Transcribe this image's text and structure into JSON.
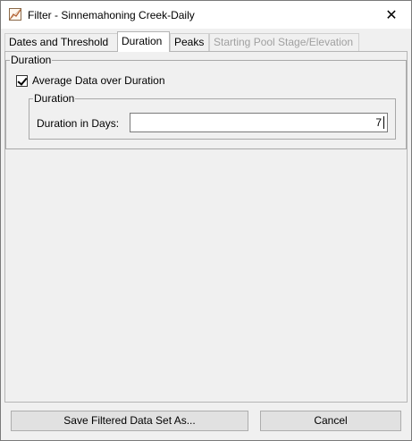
{
  "window": {
    "title": "Filter - Sinnemahoning Creek-Daily",
    "close_glyph": "✕"
  },
  "tabs": [
    {
      "label": "Dates and Threshold",
      "state": "normal"
    },
    {
      "label": "Duration",
      "state": "active"
    },
    {
      "label": "Peaks",
      "state": "normal"
    },
    {
      "label": "Starting Pool Stage/Elevation",
      "state": "disabled"
    }
  ],
  "duration_group": {
    "legend": "Duration",
    "average_checkbox": {
      "label": "Average Data over Duration",
      "checked": true
    },
    "inner_group": {
      "legend": "Duration",
      "field_label": "Duration in Days:",
      "field_value": "7"
    }
  },
  "buttons": {
    "save_label": "Save Filtered Data Set As...",
    "cancel_label": "Cancel"
  }
}
